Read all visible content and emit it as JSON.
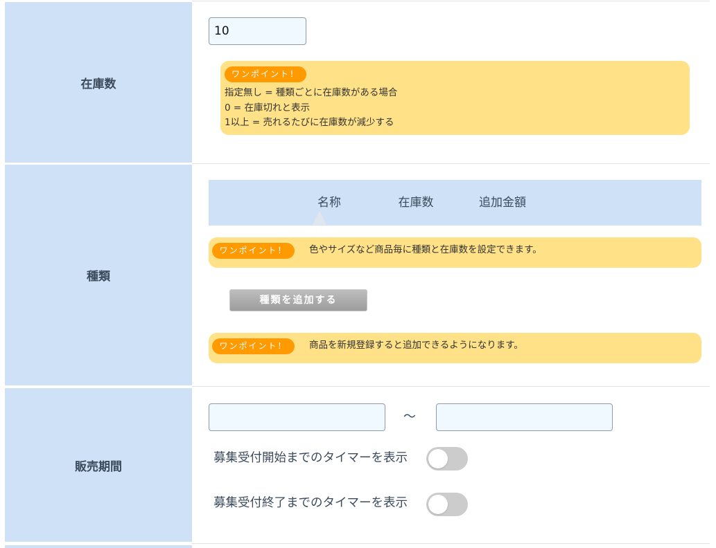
{
  "stock": {
    "label": "在庫数",
    "input_value": "10",
    "tip": {
      "badge": "ワンポイント！",
      "lines": [
        "指定無し = 種類ごとに在庫数がある場合",
        "0 = 在庫切れと表示",
        "1以上 = 売れるたびに在庫数が減少する"
      ]
    }
  },
  "variants": {
    "label": "種類",
    "columns": [
      "名称",
      "在庫数",
      "追加金額"
    ],
    "tip1": {
      "badge": "ワンポイント！",
      "text": "色やサイズなど商品毎に種類と在庫数を設定できます。"
    },
    "add_button": "種類を追加する",
    "tip2": {
      "badge": "ワンポイント！",
      "text": "商品を新規登録すると追加できるようになります。"
    }
  },
  "sale_period": {
    "label": "販売期間",
    "start_value": "",
    "end_value": "",
    "separator": "〜",
    "timer_start": {
      "label": "募集受付開始までのタイマーを表示",
      "on": false
    },
    "timer_end": {
      "label": "募集受付終了までのタイマーを表示",
      "on": false
    }
  },
  "icons": {
    "header_marker": "caret-up-icon",
    "toggle": "toggle-switch-icon"
  },
  "colors": {
    "label_bg": "#cfe1f6",
    "tip_bg": "#ffe187",
    "badge_bg": "#ff9a00",
    "input_bg": "#eff9ff",
    "text": "#3b4a5c",
    "toggle_off": "#cccccc"
  }
}
